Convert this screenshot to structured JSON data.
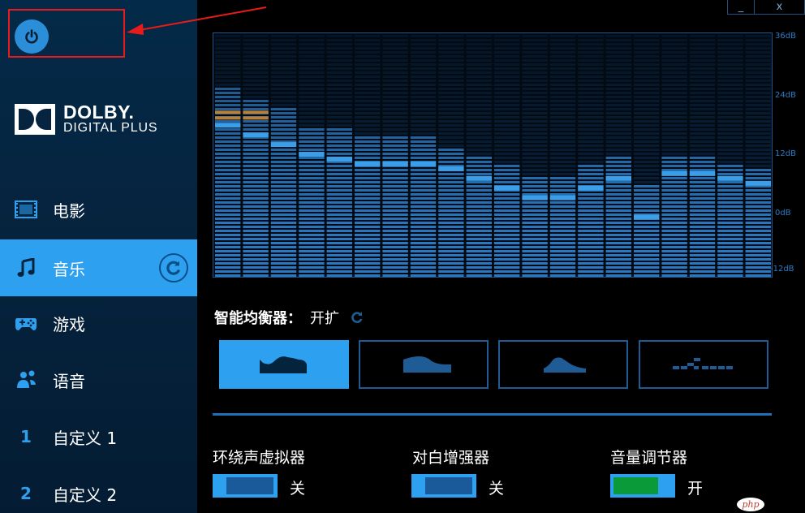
{
  "window": {
    "minimize_label": "_",
    "close_label": "x"
  },
  "brand": {
    "line1": "DOLBY.",
    "line2": "DIGITAL PLUS"
  },
  "sidebar": {
    "items": [
      {
        "label": "电影",
        "icon": "film-icon"
      },
      {
        "label": "音乐",
        "icon": "music-note-icon",
        "active": true
      },
      {
        "label": "游戏",
        "icon": "gamepad-icon"
      },
      {
        "label": "语音",
        "icon": "voice-icon"
      },
      {
        "label": "自定义 1",
        "icon": "custom-1-icon",
        "glyph": "1"
      },
      {
        "label": "自定义 2",
        "icon": "custom-2-icon",
        "glyph": "2"
      }
    ]
  },
  "equalizer": {
    "db_labels": [
      "36dB",
      "24dB",
      "12dB",
      "0dB",
      "-12dB"
    ],
    "db_scale": [
      36,
      24,
      12,
      0,
      -12
    ],
    "bands": [
      18,
      16,
      14,
      12,
      11,
      10,
      10,
      10,
      9,
      7,
      5,
      3,
      3,
      5,
      7,
      -1,
      8,
      8,
      7,
      6
    ],
    "levels": [
      26,
      24,
      22,
      18,
      18,
      16,
      16,
      16,
      14,
      12,
      10,
      8,
      8,
      10,
      12,
      6,
      12,
      12,
      10,
      9
    ],
    "peak_bands": [
      21,
      21
    ],
    "colors": {
      "bar": "#2a78c0",
      "bar_dim": "#0d2b4c",
      "marker": "#3a9ee8",
      "peak": "#b8803a"
    }
  },
  "smart_eq": {
    "label": "智能均衡器：",
    "value": "开扩"
  },
  "presets": [
    {
      "name": "open",
      "active": true
    },
    {
      "name": "rich",
      "active": false
    },
    {
      "name": "focused",
      "active": false
    },
    {
      "name": "custom",
      "active": false
    }
  ],
  "toggles": [
    {
      "label": "环绕声虚拟器",
      "state": "关",
      "on": false
    },
    {
      "label": "对白增强器",
      "state": "关",
      "on": false
    },
    {
      "label": "音量调节器",
      "state": "开",
      "on": true
    }
  ],
  "badge": "php"
}
